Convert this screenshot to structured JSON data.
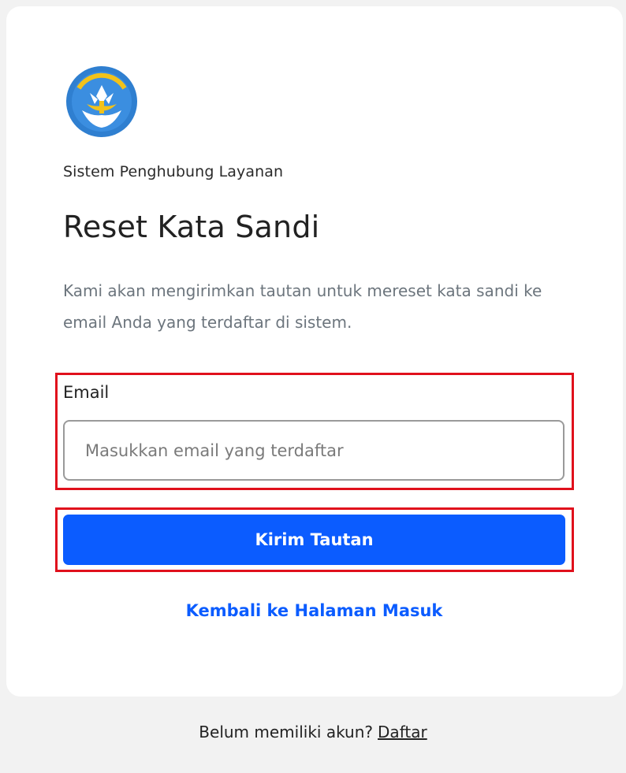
{
  "app": {
    "subtitle": "Sistem Penghubung Layanan",
    "logo_icon": "tut-wuri-handayani-logo-icon"
  },
  "page": {
    "title": "Reset Kata Sandi",
    "description": "Kami akan mengirimkan tautan untuk mereset kata sandi ke email Anda yang terdaftar di sistem."
  },
  "form": {
    "email_label": "Email",
    "email_value": "",
    "email_placeholder": "Masukkan email yang terdaftar",
    "submit_label": "Kirim Tautan",
    "back_link_label": "Kembali ke Halaman Masuk"
  },
  "footer": {
    "prompt": "Belum memiliki akun?",
    "register_label": "Daftar"
  },
  "colors": {
    "primary": "#0b5cff",
    "highlight": "#e0101c",
    "logo_blue": "#2f7fd0",
    "logo_yellow": "#f2c21a"
  }
}
